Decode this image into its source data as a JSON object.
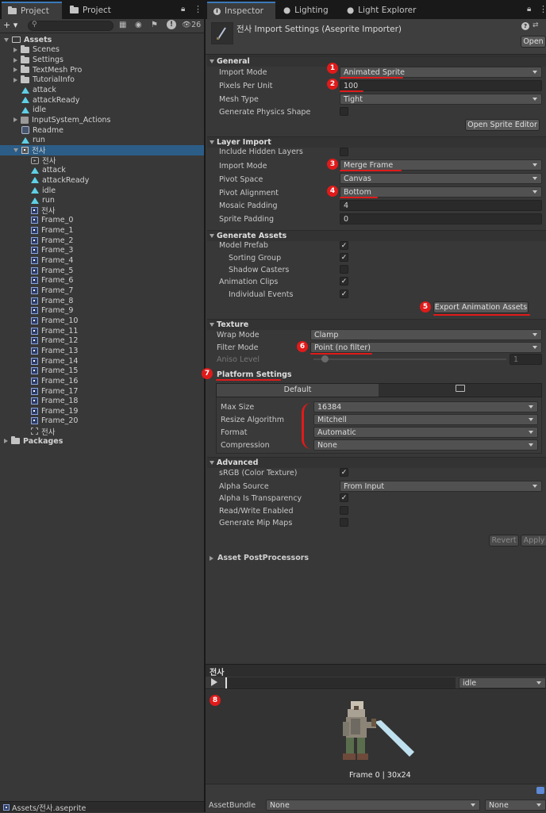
{
  "left": {
    "tabs": [
      "Project",
      "Project"
    ],
    "toolbar": {
      "add_label": "+ ▾",
      "hidden_count": "26"
    },
    "tree": [
      {
        "label": "Assets",
        "icon": "folder-open-icon",
        "indent": 0,
        "expanded": true,
        "bold": true
      },
      {
        "label": "Scenes",
        "icon": "folder-icon",
        "indent": 1
      },
      {
        "label": "Settings",
        "icon": "folder-icon",
        "indent": 1
      },
      {
        "label": "TextMesh Pro",
        "icon": "folder-icon",
        "indent": 1
      },
      {
        "label": "TutorialInfo",
        "icon": "folder-icon",
        "indent": 1
      },
      {
        "label": "attack",
        "icon": "animation-clip-icon",
        "indent": 1,
        "leaf": true
      },
      {
        "label": "attackReady",
        "icon": "animation-clip-icon",
        "indent": 1,
        "leaf": true
      },
      {
        "label": "idle",
        "icon": "animation-clip-icon",
        "indent": 1,
        "leaf": true
      },
      {
        "label": "InputSystem_Actions",
        "icon": "input-actions-icon",
        "indent": 1
      },
      {
        "label": "Readme",
        "icon": "readme-icon",
        "indent": 1,
        "leaf": true
      },
      {
        "label": "run",
        "icon": "animation-clip-icon",
        "indent": 1,
        "leaf": true
      },
      {
        "label": "전사",
        "icon": "aseprite-asset-icon",
        "indent": 1,
        "expanded": true,
        "selected": true
      },
      {
        "label": "전사",
        "icon": "animator-controller-icon",
        "indent": 2,
        "leaf": true
      },
      {
        "label": "attack",
        "icon": "animation-clip-icon",
        "indent": 2,
        "leaf": true
      },
      {
        "label": "attackReady",
        "icon": "animation-clip-icon",
        "indent": 2,
        "leaf": true
      },
      {
        "label": "idle",
        "icon": "animation-clip-icon",
        "indent": 2,
        "leaf": true
      },
      {
        "label": "run",
        "icon": "animation-clip-icon",
        "indent": 2,
        "leaf": true
      },
      {
        "label": "전사",
        "icon": "sprite-icon",
        "indent": 2,
        "leaf": true
      },
      {
        "label": "Frame_0",
        "icon": "sprite-icon",
        "indent": 2,
        "leaf": true
      },
      {
        "label": "Frame_1",
        "icon": "sprite-icon",
        "indent": 2,
        "leaf": true
      },
      {
        "label": "Frame_2",
        "icon": "sprite-icon",
        "indent": 2,
        "leaf": true
      },
      {
        "label": "Frame_3",
        "icon": "sprite-icon",
        "indent": 2,
        "leaf": true
      },
      {
        "label": "Frame_4",
        "icon": "sprite-icon",
        "indent": 2,
        "leaf": true
      },
      {
        "label": "Frame_5",
        "icon": "sprite-icon",
        "indent": 2,
        "leaf": true
      },
      {
        "label": "Frame_6",
        "icon": "sprite-icon",
        "indent": 2,
        "leaf": true
      },
      {
        "label": "Frame_7",
        "icon": "sprite-icon",
        "indent": 2,
        "leaf": true
      },
      {
        "label": "Frame_8",
        "icon": "sprite-icon",
        "indent": 2,
        "leaf": true
      },
      {
        "label": "Frame_9",
        "icon": "sprite-icon",
        "indent": 2,
        "leaf": true
      },
      {
        "label": "Frame_10",
        "icon": "sprite-icon",
        "indent": 2,
        "leaf": true
      },
      {
        "label": "Frame_11",
        "icon": "sprite-icon",
        "indent": 2,
        "leaf": true
      },
      {
        "label": "Frame_12",
        "icon": "sprite-icon",
        "indent": 2,
        "leaf": true
      },
      {
        "label": "Frame_13",
        "icon": "sprite-icon",
        "indent": 2,
        "leaf": true
      },
      {
        "label": "Frame_14",
        "icon": "sprite-icon",
        "indent": 2,
        "leaf": true
      },
      {
        "label": "Frame_15",
        "icon": "sprite-icon",
        "indent": 2,
        "leaf": true
      },
      {
        "label": "Frame_16",
        "icon": "sprite-icon",
        "indent": 2,
        "leaf": true
      },
      {
        "label": "Frame_17",
        "icon": "sprite-icon",
        "indent": 2,
        "leaf": true
      },
      {
        "label": "Frame_18",
        "icon": "sprite-icon",
        "indent": 2,
        "leaf": true
      },
      {
        "label": "Frame_19",
        "icon": "sprite-icon",
        "indent": 2,
        "leaf": true
      },
      {
        "label": "Frame_20",
        "icon": "sprite-icon",
        "indent": 2,
        "leaf": true
      },
      {
        "label": "전사",
        "icon": "tilemap-icon",
        "indent": 2,
        "leaf": true
      },
      {
        "label": "Packages",
        "icon": "folder-icon",
        "indent": 0,
        "bold": true
      }
    ],
    "status_path": "Assets/전사.aseprite"
  },
  "right": {
    "tabs": [
      "Inspector",
      "Lighting",
      "Light Explorer"
    ],
    "header": {
      "title": "전사 Import Settings (Aseprite Importer)",
      "open_label": "Open"
    },
    "general": {
      "title": "General",
      "import_mode_label": "Import Mode",
      "import_mode": "Animated Sprite",
      "ppu_label": "Pixels Per Unit",
      "ppu": "100",
      "mesh_type_label": "Mesh Type",
      "mesh_type": "Tight",
      "gen_physics_label": "Generate Physics Shape",
      "open_sprite_editor": "Open Sprite Editor"
    },
    "layer": {
      "title": "Layer Import",
      "hidden_layers_label": "Include Hidden Layers",
      "import_mode_label": "Import Mode",
      "import_mode": "Merge Frame",
      "pivot_space_label": "Pivot Space",
      "pivot_space": "Canvas",
      "pivot_align_label": "Pivot Alignment",
      "pivot_align": "Bottom",
      "mosaic_label": "Mosaic Padding",
      "mosaic": "4",
      "sprite_pad_label": "Sprite Padding",
      "sprite_pad": "0"
    },
    "generate": {
      "title": "Generate Assets",
      "model_prefab": "Model Prefab",
      "sorting_group": "Sorting Group",
      "shadow_casters": "Shadow Casters",
      "animation_clips": "Animation Clips",
      "individual_events": "Individual Events",
      "export_label": "Export Animation Assets"
    },
    "texture": {
      "title": "Texture",
      "wrap_label": "Wrap Mode",
      "wrap": "Clamp",
      "filter_label": "Filter Mode",
      "filter": "Point (no filter)",
      "aniso_label": "Aniso Level",
      "aniso": "1"
    },
    "platform": {
      "title": "Platform Settings",
      "tab_default": "Default",
      "max_size_label": "Max Size",
      "max_size": "16384",
      "resize_label": "Resize Algorithm",
      "resize": "Mitchell",
      "format_label": "Format",
      "format": "Automatic",
      "compression_label": "Compression",
      "compression": "None"
    },
    "advanced": {
      "title": "Advanced",
      "srgb": "sRGB (Color Texture)",
      "alpha_source_label": "Alpha Source",
      "alpha_source": "From Input",
      "alpha_transp": "Alpha Is Transparency",
      "read_write": "Read/Write Enabled",
      "mipmaps": "Generate Mip Maps",
      "revert": "Revert",
      "apply": "Apply"
    },
    "postprocessors": "Asset PostProcessors",
    "preview": {
      "title": "전사",
      "clip": "idle",
      "caption": "Frame 0 | 30x24"
    },
    "assetbundle": {
      "label": "AssetBundle",
      "name": "None",
      "variant": "None"
    }
  },
  "badges": [
    "1",
    "2",
    "3",
    "4",
    "5",
    "6",
    "7",
    "8"
  ],
  "accent": "#e01a1a"
}
